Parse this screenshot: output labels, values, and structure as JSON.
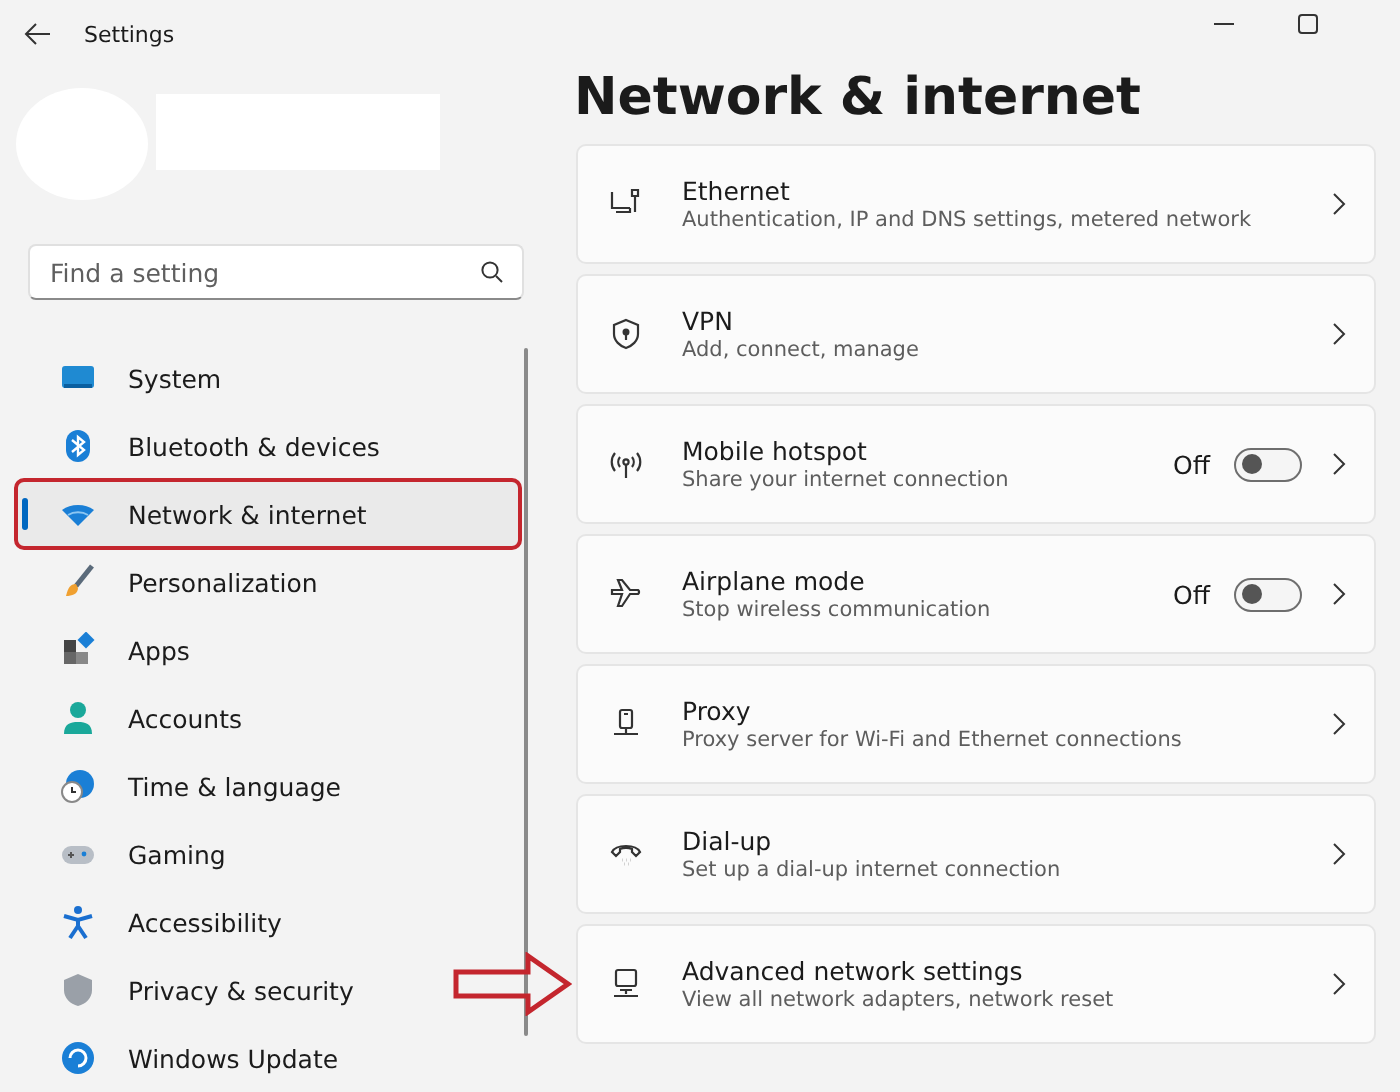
{
  "window": {
    "title": "Settings"
  },
  "search": {
    "placeholder": "Find a setting"
  },
  "nav": [
    {
      "label": "System",
      "selected": false,
      "annotated": false
    },
    {
      "label": "Bluetooth & devices",
      "selected": false,
      "annotated": false
    },
    {
      "label": "Network & internet",
      "selected": true,
      "annotated": true
    },
    {
      "label": "Personalization",
      "selected": false,
      "annotated": false
    },
    {
      "label": "Apps",
      "selected": false,
      "annotated": false
    },
    {
      "label": "Accounts",
      "selected": false,
      "annotated": false
    },
    {
      "label": "Time & language",
      "selected": false,
      "annotated": false
    },
    {
      "label": "Gaming",
      "selected": false,
      "annotated": false
    },
    {
      "label": "Accessibility",
      "selected": false,
      "annotated": false
    },
    {
      "label": "Privacy & security",
      "selected": false,
      "annotated": false
    },
    {
      "label": "Windows Update",
      "selected": false,
      "annotated": false
    }
  ],
  "page_title": "Network & internet",
  "cards": [
    {
      "kind": "link",
      "title": "Ethernet",
      "subtitle": "Authentication, IP and DNS settings, metered network",
      "annotated": false
    },
    {
      "kind": "link",
      "title": "VPN",
      "subtitle": "Add, connect, manage",
      "annotated": false
    },
    {
      "kind": "toggle",
      "title": "Mobile hotspot",
      "subtitle": "Share your internet connection",
      "state_text": "Off",
      "on": false,
      "annotated": false
    },
    {
      "kind": "toggle",
      "title": "Airplane mode",
      "subtitle": "Stop wireless communication",
      "state_text": "Off",
      "on": false,
      "annotated": false
    },
    {
      "kind": "link",
      "title": "Proxy",
      "subtitle": "Proxy server for Wi-Fi and Ethernet connections",
      "annotated": false
    },
    {
      "kind": "link",
      "title": "Dial-up",
      "subtitle": "Set up a dial-up internet connection",
      "annotated": false
    },
    {
      "kind": "link",
      "title": "Advanced network settings",
      "subtitle": "View all network adapters, network reset",
      "annotated": true
    }
  ]
}
